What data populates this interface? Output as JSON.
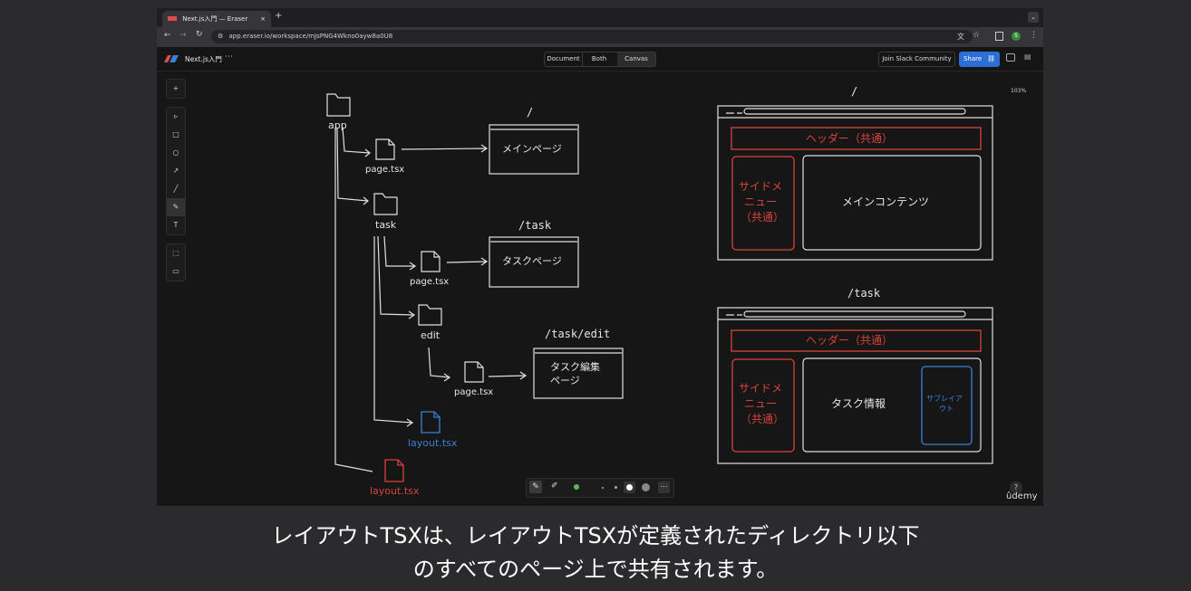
{
  "browser": {
    "tab_title": "Next.js入門 — Eraser",
    "url": "app.eraser.io/workspace/mJsPNG4Wkno0ayw8a0U8"
  },
  "app_header": {
    "doc_title": "Next.js入門",
    "more_icon": "ellipsis-icon",
    "view_tabs": [
      "Document",
      "Both",
      "Canvas"
    ],
    "active_view": "Canvas",
    "join_slack": "Join Slack Community",
    "share": "Share",
    "zoom": "103%"
  },
  "tree": {
    "app": "app",
    "page_main": "page.tsx",
    "main_route": "/",
    "main_page": "メインページ",
    "task": "task",
    "page_task": "page.tsx",
    "task_route": "/task",
    "task_page": "タスクページ",
    "edit": "edit",
    "page_edit": "page.tsx",
    "edit_route": "/task/edit",
    "edit_page_line1": "タスク編集",
    "edit_page_line2": "ページ",
    "layout_task": "layout.tsx",
    "layout_app": "layout.tsx"
  },
  "wireframe_root": {
    "route": "/",
    "header": "ヘッダー（共通）",
    "sidebar": [
      "サイドメ",
      "ニュー",
      "（共通）"
    ],
    "main": "メインコンテンツ"
  },
  "wireframe_task": {
    "route": "/task",
    "header": "ヘッダー（共通）",
    "sidebar": [
      "サイドメ",
      "ニュー",
      "（共通）"
    ],
    "main": "タスク情報",
    "sub_layout": [
      "サブレイア",
      "ウト"
    ]
  },
  "colors": {
    "red": "#d9423c",
    "blue": "#3b7fd9",
    "stroke": "#e6e6e6"
  },
  "caption": {
    "line1": "レイアウトTSXは、レイアウトTSXが定義されたディレクトリ以下",
    "line2": "のすべてのページ上で共有されます。"
  },
  "watermark": "ûdemy"
}
